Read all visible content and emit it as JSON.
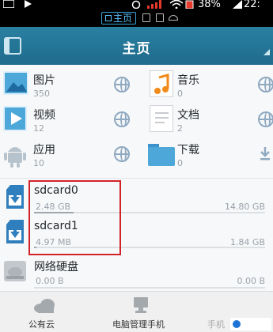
{
  "status_bar": {
    "battery": "38%",
    "time": "22:"
  },
  "tab_bar": {
    "active_tab": "主页"
  },
  "header": {
    "title": "主页"
  },
  "categories": [
    {
      "name": "图片",
      "count": "350",
      "icon": "image-icon"
    },
    {
      "name": "音乐",
      "count": "0",
      "icon": "music-icon"
    },
    {
      "name": "视频",
      "count": "12",
      "icon": "video-icon"
    },
    {
      "name": "文档",
      "count": "2",
      "icon": "document-icon"
    },
    {
      "name": "应用",
      "count": "10",
      "icon": "android-app-icon"
    },
    {
      "name": "下载",
      "count": "0",
      "icon": "folder-icon"
    }
  ],
  "drives": [
    {
      "name": "sdcard0",
      "used": "2.48 GB",
      "total": "14.80 GB",
      "fill": 0.17
    },
    {
      "name": "sdcard1",
      "used": "4.97 MB",
      "total": "1.84 GB",
      "fill": 0.01
    },
    {
      "name": "网络硬盘",
      "used": "0.00 B",
      "total": "0.00 B",
      "fill": 0.0
    }
  ],
  "bottom_nav": {
    "cloud": "公有云",
    "pc_manager": "电脑管理手机",
    "phone": "手机"
  },
  "colors": {
    "header": "#2a80a2",
    "highlight_box": "#d3232a",
    "sd_icon": "#2f7fbe"
  }
}
